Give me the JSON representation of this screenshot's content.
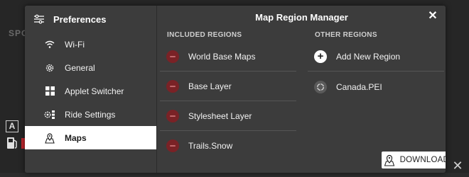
{
  "background": {
    "label": "SPC",
    "badge": "A",
    "close_glyph": "✕"
  },
  "sidebar": {
    "title": "Preferences",
    "title_icon": "sliders-icon",
    "items": [
      {
        "label": "Wi-Fi",
        "icon": "wifi-icon",
        "selected": false
      },
      {
        "label": "General",
        "icon": "gear-icon",
        "selected": false
      },
      {
        "label": "Applet Switcher",
        "icon": "grid-icon",
        "selected": false
      },
      {
        "label": "Ride Settings",
        "icon": "ride-settings-icon",
        "selected": false
      },
      {
        "label": "Maps",
        "icon": "map-pin-icon",
        "selected": true
      }
    ]
  },
  "main": {
    "title": "Map Region Manager",
    "close_glyph": "✕",
    "included_header": "INCLUDED REGIONS",
    "other_header": "OTHER REGIONS",
    "included": [
      {
        "label": "World Base Maps"
      },
      {
        "label": "Base Layer"
      },
      {
        "label": "Stylesheet Layer"
      },
      {
        "label": "Trails.Snow"
      }
    ],
    "other": [
      {
        "label": "Add New Region",
        "kind": "add"
      },
      {
        "label": "Canada.PEI",
        "kind": "loading"
      }
    ],
    "download_label": "DOWNLOAD UPDATE"
  },
  "colors": {
    "dialog_bg": "#3c3c3c",
    "remove_badge": "#7a2226",
    "selected_bg": "#ffffff"
  }
}
